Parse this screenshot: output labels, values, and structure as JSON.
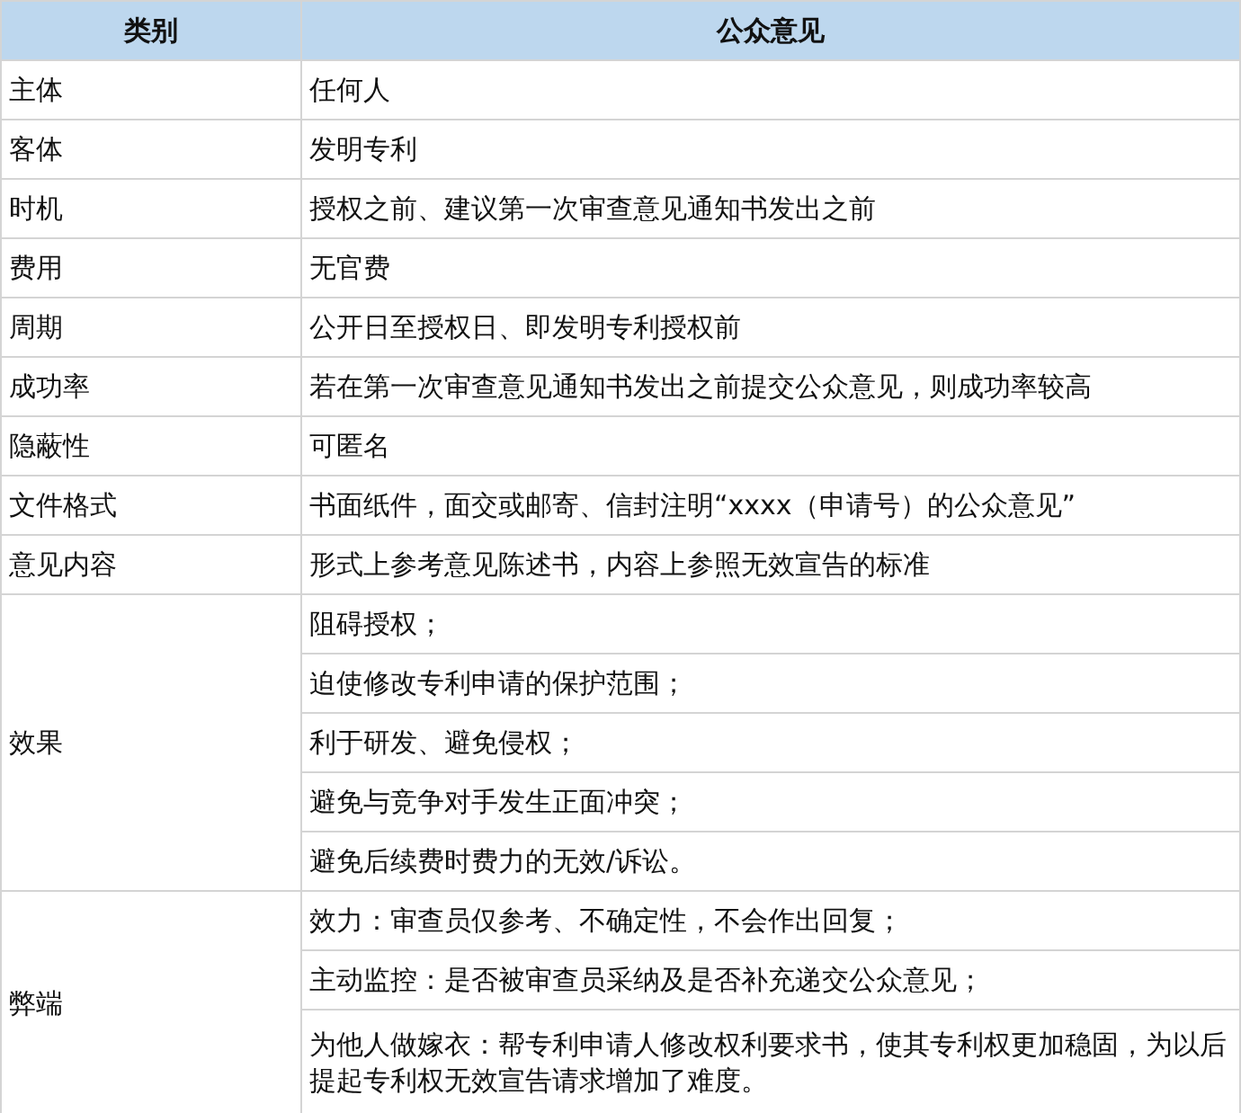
{
  "table": {
    "columns": [
      "类别",
      "公众意见"
    ],
    "rows": [
      {
        "category": "主体",
        "values": [
          "任何人"
        ]
      },
      {
        "category": "客体",
        "values": [
          "发明专利"
        ]
      },
      {
        "category": "时机",
        "values": [
          "授权之前、建议第一次审查意见通知书发出之前"
        ]
      },
      {
        "category": "费用",
        "values": [
          "无官费"
        ]
      },
      {
        "category": "周期",
        "values": [
          "公开日至授权日、即发明专利授权前"
        ]
      },
      {
        "category": "成功率",
        "values": [
          "若在第一次审查意见通知书发出之前提交公众意见，则成功率较高"
        ]
      },
      {
        "category": "隐蔽性",
        "values": [
          "可匿名"
        ]
      },
      {
        "category": "文件格式",
        "values": [
          "书面纸件，面交或邮寄、信封注明“xxxx（申请号）的公众意见”"
        ]
      },
      {
        "category": "意见内容",
        "values": [
          "形式上参考意见陈述书，内容上参照无效宣告的标准"
        ]
      },
      {
        "category": "效果",
        "values": [
          "阻碍授权；",
          "迫使修改专利申请的保护范围；",
          "利于研发、避免侵权；",
          "避免与竞争对手发生正面冲突；",
          "避免后续费时费力的无效/诉讼。"
        ]
      },
      {
        "category": "弊端",
        "values": [
          "效力：审查员仅参考、不确定性，不会作出回复；",
          "主动监控：是否被审查员采纳及是否补充递交公众意见；",
          "为他人做嫁衣：帮专利申请人修改权利要求书，使其专利权更加稳固，为以后提起专利权无效宣告请求增加了难度。"
        ]
      }
    ]
  }
}
